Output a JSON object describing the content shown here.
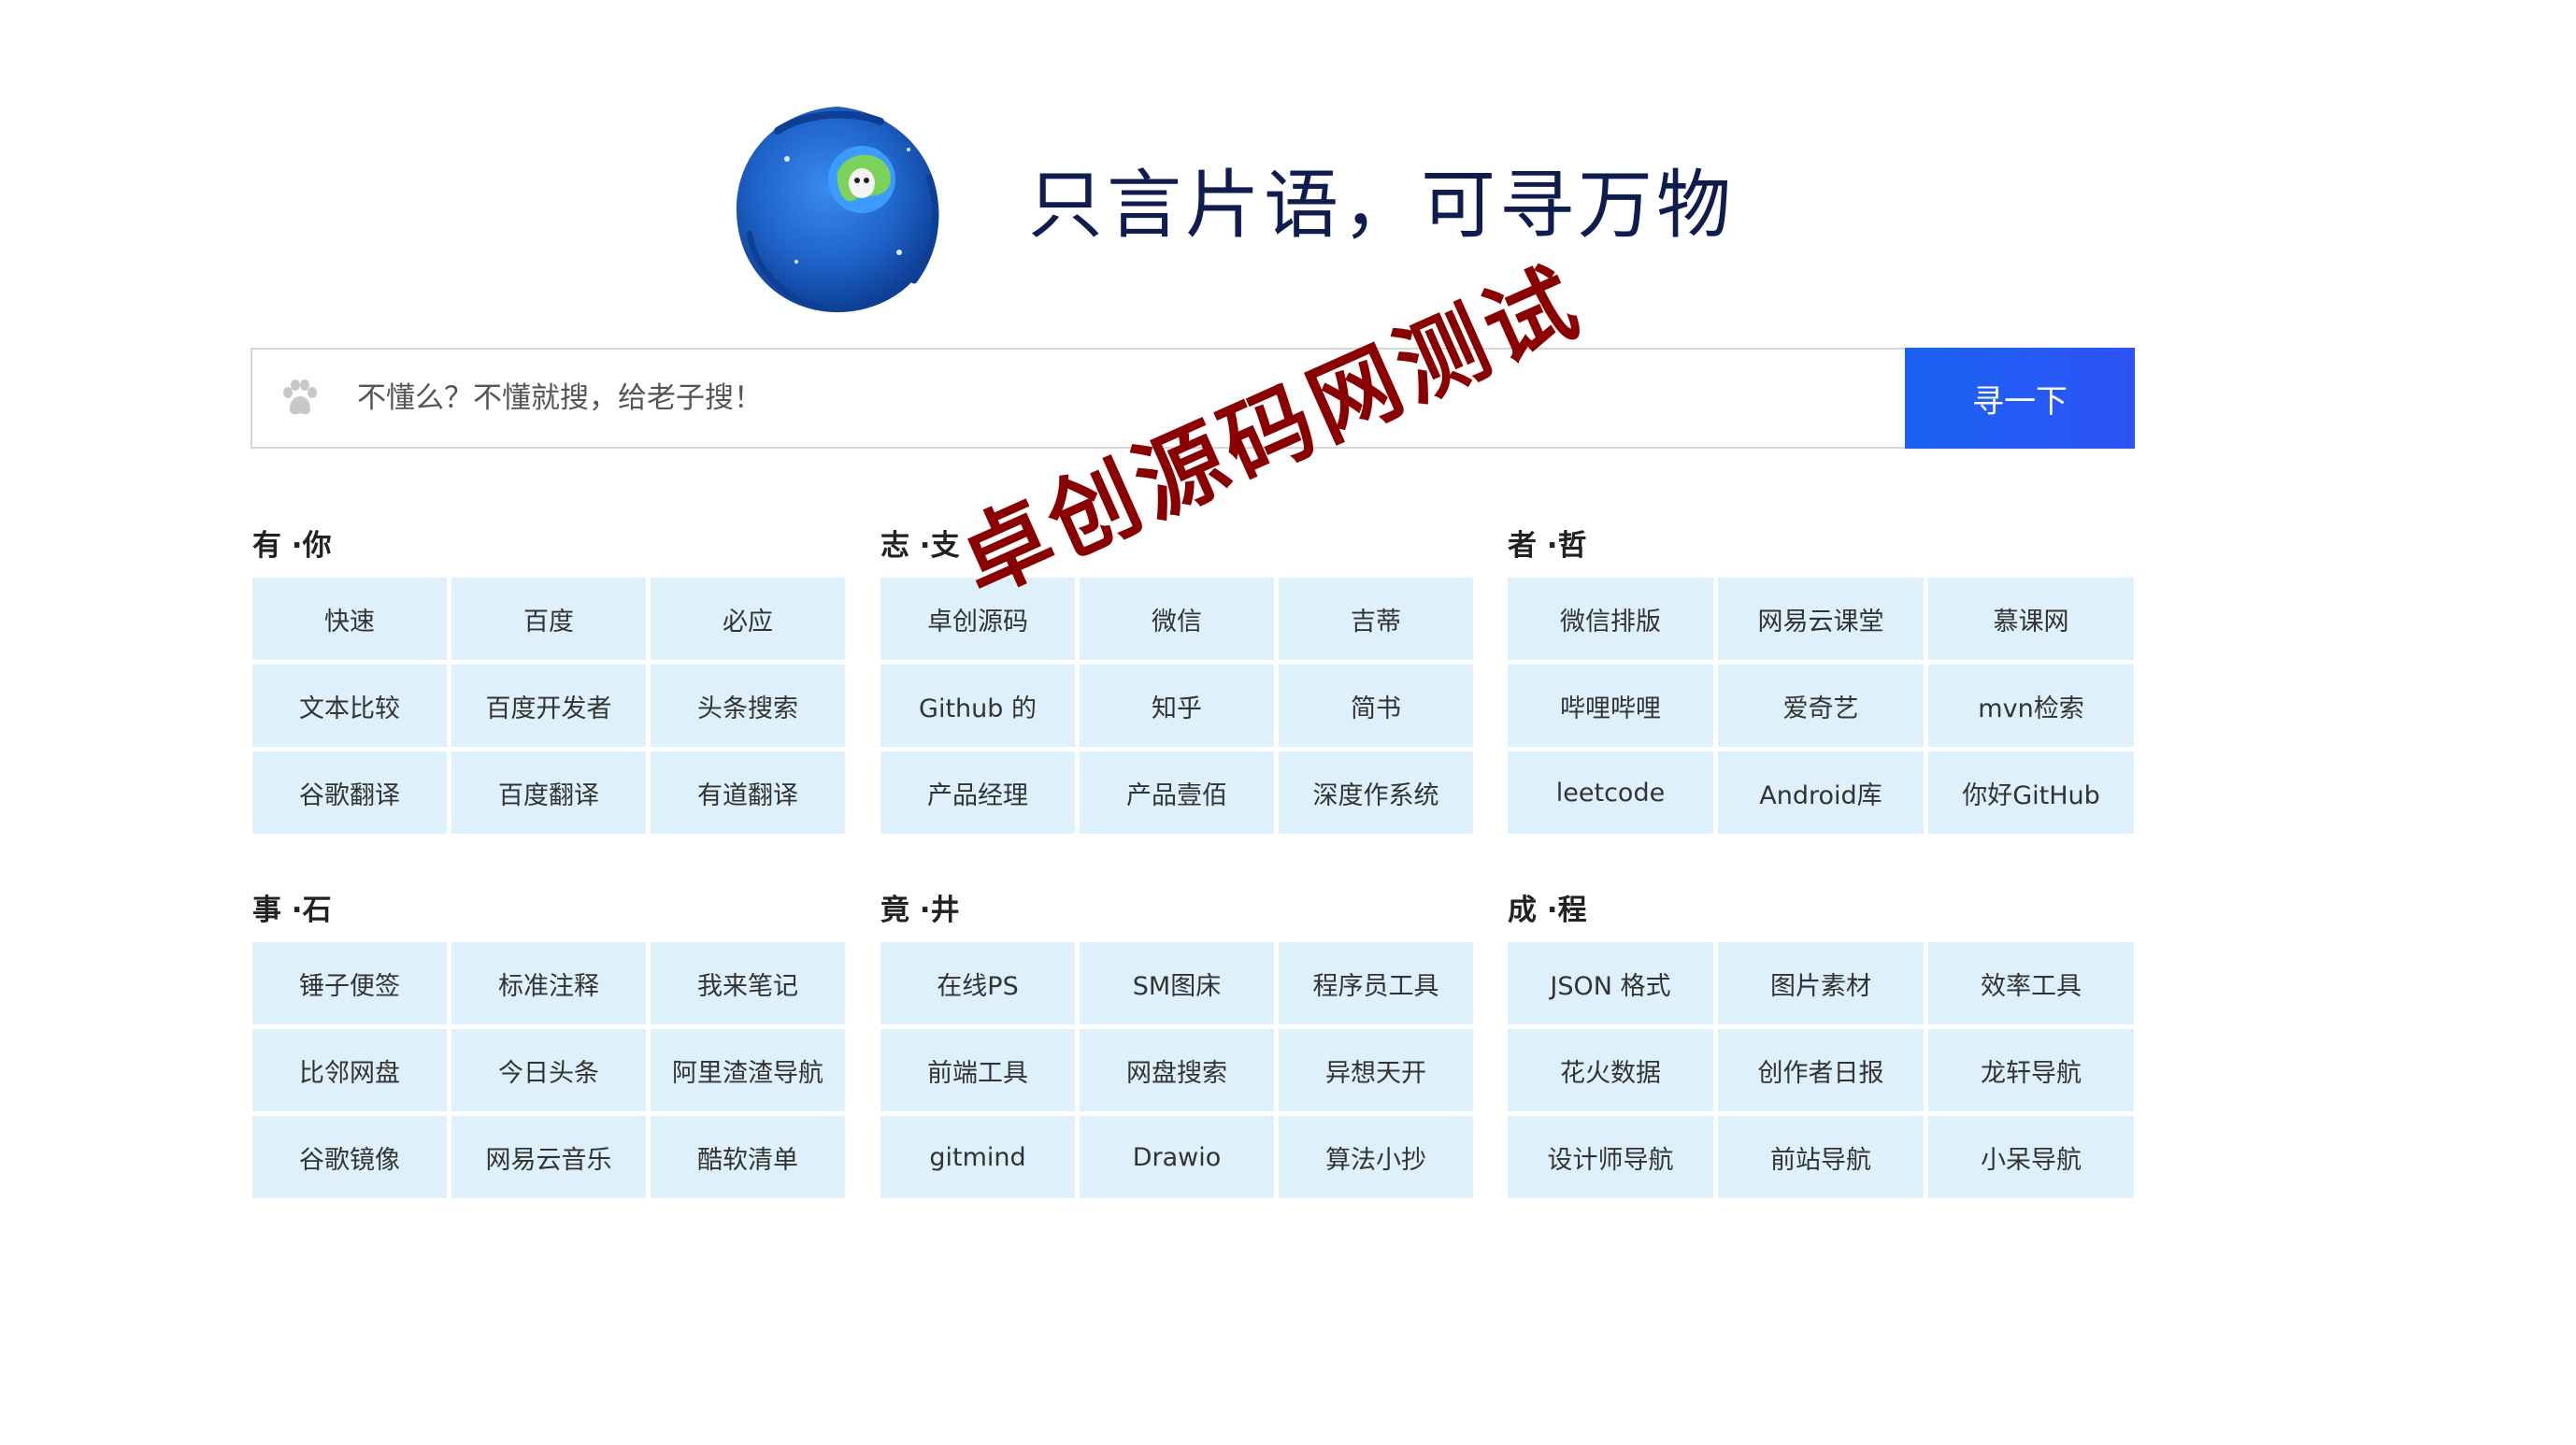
{
  "header": {
    "slogan": "只言片语，可寻万物",
    "logo_icon": "earth-logo-icon"
  },
  "search": {
    "placeholder": "不懂么？不懂就搜，给老子搜！",
    "value": "",
    "button_label": "寻一下",
    "engine_icon": "baidu-paw-icon"
  },
  "groups": [
    {
      "title": "有 ·你",
      "links": [
        "快速",
        "百度",
        "必应",
        "文本比较",
        "百度开发者",
        "头条搜索",
        "谷歌翻译",
        "百度翻译",
        "有道翻译"
      ]
    },
    {
      "title": "志 ·支",
      "links": [
        "卓创源码",
        "微信",
        "吉蒂",
        "Github 的",
        "知乎",
        "简书",
        "产品经理",
        "产品壹佰",
        "深度作系统"
      ]
    },
    {
      "title": "者 ·哲",
      "links": [
        "微信排版",
        "网易云课堂",
        "慕课网",
        "哔哩哔哩",
        "爱奇艺",
        "mvn检索",
        "leetcode",
        "Android库",
        "你好GitHub"
      ]
    },
    {
      "title": "事 ·石",
      "links": [
        "锤子便签",
        "标准注释",
        "我来笔记",
        "比邻网盘",
        "今日头条",
        "阿里渣渣导航",
        "谷歌镜像",
        "网易云音乐",
        "酷软清单"
      ]
    },
    {
      "title": "竟 ·井",
      "links": [
        "在线PS",
        "SM图床",
        "程序员工具",
        "前端工具",
        "网盘搜索",
        "异想天开",
        "gitmind",
        "Drawio",
        "算法小抄"
      ]
    },
    {
      "title": "成 ·程",
      "links": [
        "JSON 格式",
        "图片素材",
        "效率工具",
        "花火数据",
        "创作者日报",
        "龙轩导航",
        "设计师导航",
        "前站导航",
        "小呆导航"
      ]
    }
  ],
  "watermark": "卓创源码网测试",
  "colors": {
    "accent": "#1a63f2",
    "cell_bg": "#ddf0fb",
    "slogan": "#0e1c4e",
    "watermark": "#8a0000"
  }
}
